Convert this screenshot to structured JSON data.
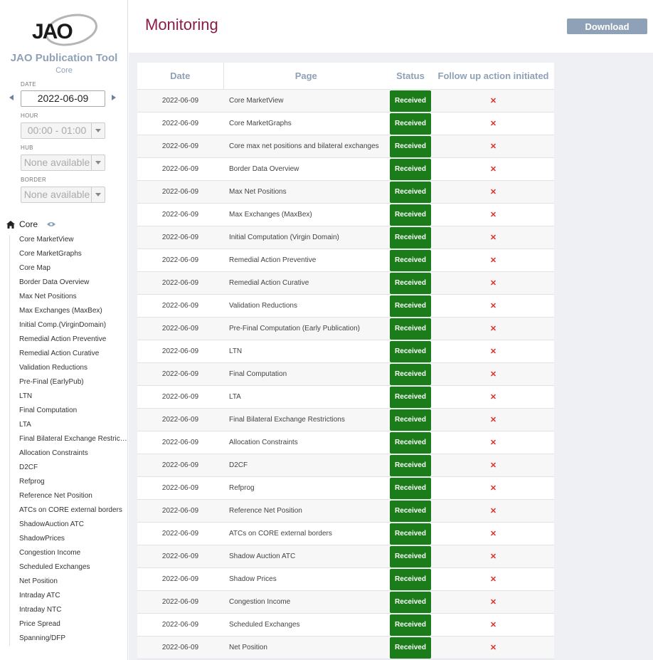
{
  "sidebar": {
    "app_title": "JAO Publication Tool",
    "app_subtitle": "Core",
    "date_label": "DATE",
    "date_value": "2022-06-09",
    "hour_label": "HOUR",
    "hour_value": "00:00 - 01:00",
    "hub_label": "HUB",
    "hub_value": "None available",
    "border_label": "BORDER",
    "border_value": "None available",
    "section_label": "Core",
    "items": [
      "Core MarketView",
      "Core MarketGraphs",
      "Core Map",
      "Border Data Overview",
      "Max Net Positions",
      "Max Exchanges (MaxBex)",
      "Initial Comp.(VirginDomain)",
      "Remedial Action Preventive",
      "Remedial Action Curative",
      "Validation Reductions",
      "Pre-Final (EarlyPub)",
      "LTN",
      "Final Computation",
      "LTA",
      "Final Bilateral Exchange Restrictions",
      "Allocation Constraints",
      "D2CF",
      "Refprog",
      "Reference Net Position",
      "ATCs on CORE external borders",
      "ShadowAuction ATC",
      "ShadowPrices",
      "Congestion Income",
      "Scheduled Exchanges",
      "Net Position",
      "Intraday ATC",
      "Intraday NTC",
      "Price Spread",
      "Spanning/DFP"
    ]
  },
  "header": {
    "title": "Monitoring",
    "download_label": "Download"
  },
  "table": {
    "columns": [
      "Date",
      "Page",
      "Status",
      "Follow up action initiated"
    ],
    "rows": [
      {
        "date": "2022-06-09",
        "page": "Core MarketView",
        "status": "Received",
        "follow": "✕"
      },
      {
        "date": "2022-06-09",
        "page": "Core MarketGraphs",
        "status": "Received",
        "follow": "✕"
      },
      {
        "date": "2022-06-09",
        "page": "Core max net positions and bilateral exchanges",
        "status": "Received",
        "follow": "✕"
      },
      {
        "date": "2022-06-09",
        "page": "Border Data Overview",
        "status": "Received",
        "follow": "✕"
      },
      {
        "date": "2022-06-09",
        "page": "Max Net Positions",
        "status": "Received",
        "follow": "✕"
      },
      {
        "date": "2022-06-09",
        "page": "Max Exchanges (MaxBex)",
        "status": "Received",
        "follow": "✕"
      },
      {
        "date": "2022-06-09",
        "page": "Initial Computation (Virgin Domain)",
        "status": "Received",
        "follow": "✕"
      },
      {
        "date": "2022-06-09",
        "page": "Remedial Action Preventive",
        "status": "Received",
        "follow": "✕"
      },
      {
        "date": "2022-06-09",
        "page": "Remedial Action Curative",
        "status": "Received",
        "follow": "✕"
      },
      {
        "date": "2022-06-09",
        "page": "Validation Reductions",
        "status": "Received",
        "follow": "✕"
      },
      {
        "date": "2022-06-09",
        "page": "Pre-Final Computation (Early Publication)",
        "status": "Received",
        "follow": "✕"
      },
      {
        "date": "2022-06-09",
        "page": "LTN",
        "status": "Received",
        "follow": "✕"
      },
      {
        "date": "2022-06-09",
        "page": "Final Computation",
        "status": "Received",
        "follow": "✕"
      },
      {
        "date": "2022-06-09",
        "page": "LTA",
        "status": "Received",
        "follow": "✕"
      },
      {
        "date": "2022-06-09",
        "page": "Final Bilateral Exchange Restrictions",
        "status": "Received",
        "follow": "✕"
      },
      {
        "date": "2022-06-09",
        "page": "Allocation Constraints",
        "status": "Received",
        "follow": "✕"
      },
      {
        "date": "2022-06-09",
        "page": "D2CF",
        "status": "Received",
        "follow": "✕"
      },
      {
        "date": "2022-06-09",
        "page": "Refprog",
        "status": "Received",
        "follow": "✕"
      },
      {
        "date": "2022-06-09",
        "page": "Reference Net Position",
        "status": "Received",
        "follow": "✕"
      },
      {
        "date": "2022-06-09",
        "page": "ATCs on CORE external borders",
        "status": "Received",
        "follow": "✕"
      },
      {
        "date": "2022-06-09",
        "page": "Shadow Auction ATC",
        "status": "Received",
        "follow": "✕"
      },
      {
        "date": "2022-06-09",
        "page": "Shadow Prices",
        "status": "Received",
        "follow": "✕"
      },
      {
        "date": "2022-06-09",
        "page": "Congestion Income",
        "status": "Received",
        "follow": "✕"
      },
      {
        "date": "2022-06-09",
        "page": "Scheduled Exchanges",
        "status": "Received",
        "follow": "✕"
      },
      {
        "date": "2022-06-09",
        "page": "Net Position",
        "status": "Received",
        "follow": "✕"
      }
    ]
  },
  "colors": {
    "title": "#8a1c4a",
    "accent": "#8fa1b6",
    "received": "#1a7d1a",
    "cross": "#e03030"
  }
}
